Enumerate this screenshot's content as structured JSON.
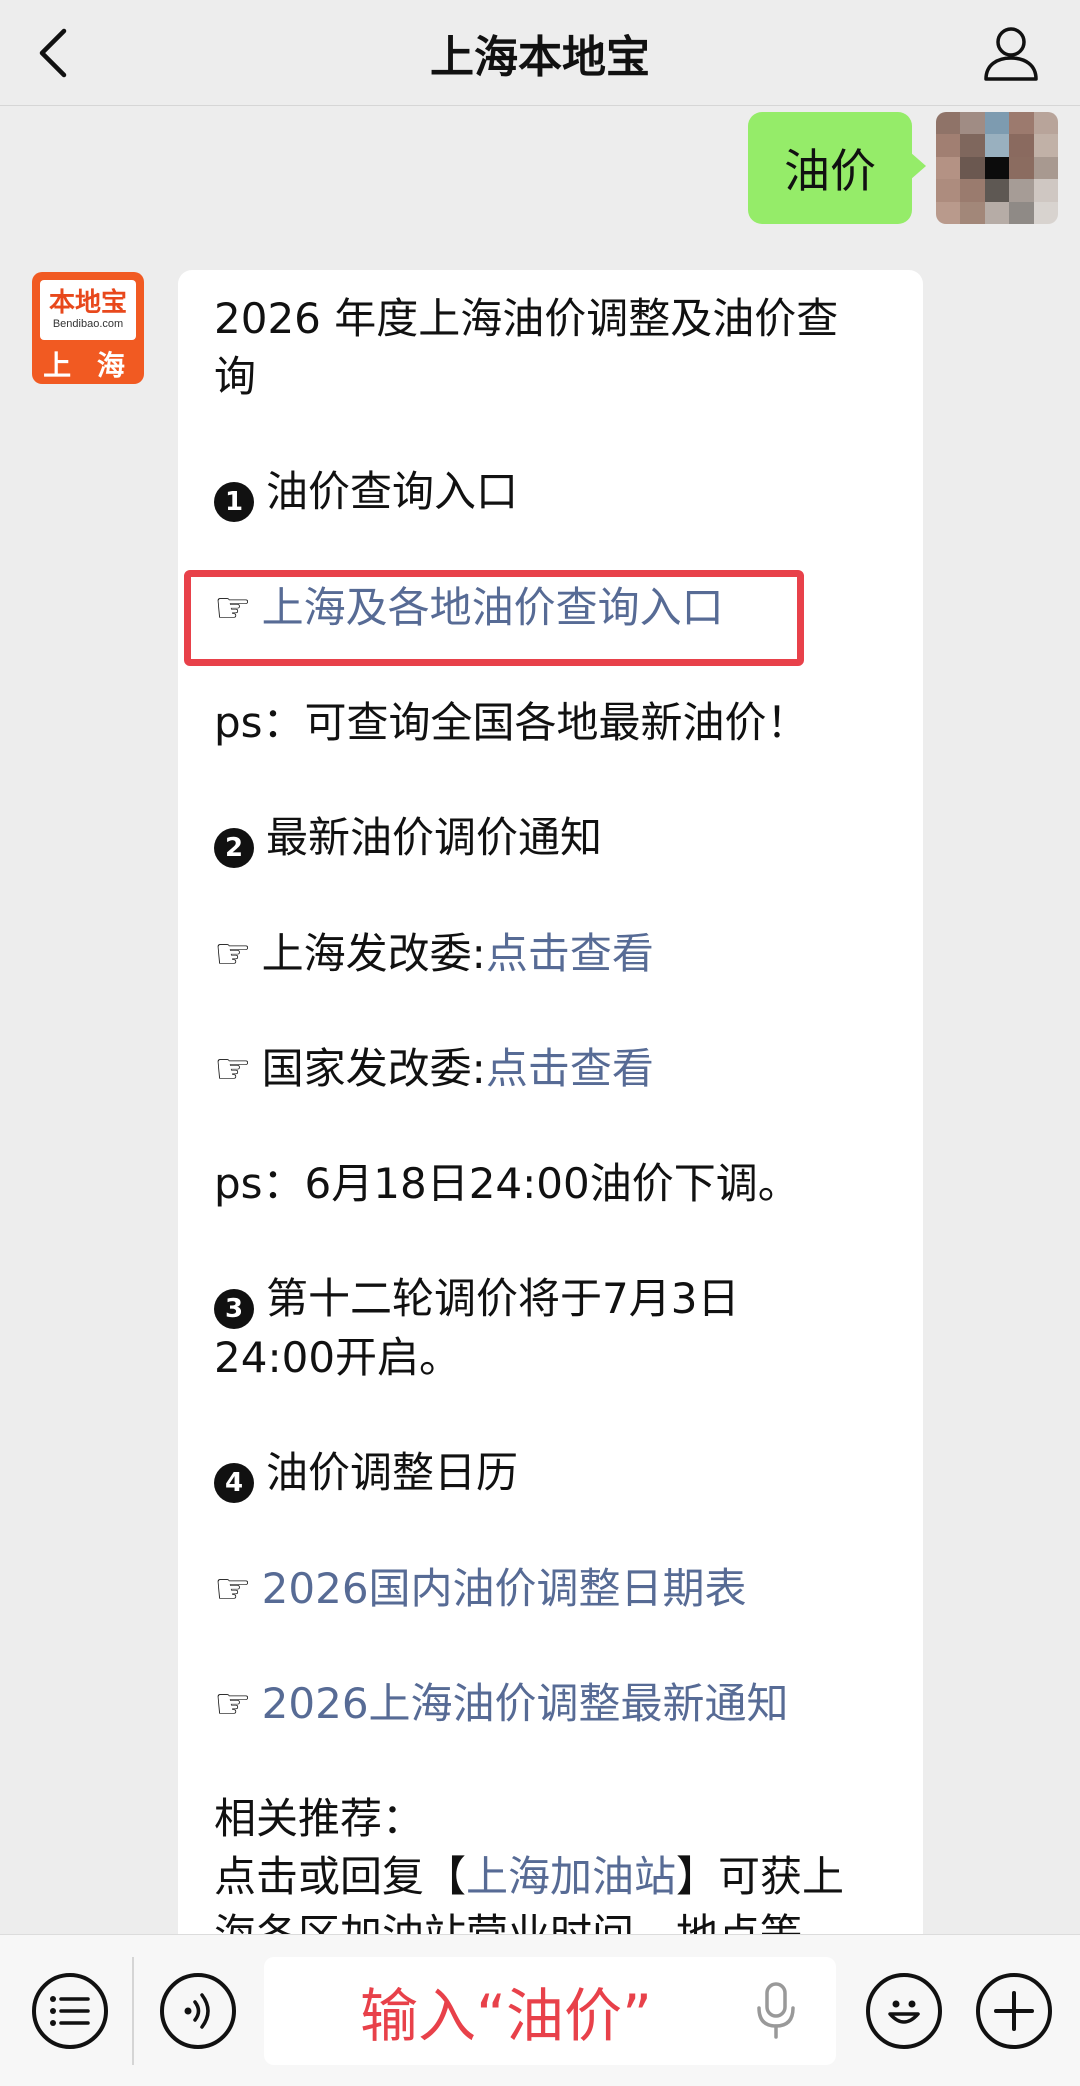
{
  "header": {
    "title": "上海本地宝"
  },
  "user_message": {
    "text": "油价"
  },
  "bot": {
    "avatar_brand": "本地宝",
    "avatar_url": "Bendibao.com",
    "avatar_city": "上 海"
  },
  "reply": {
    "title": "2026年度上海油价调整及油价查询",
    "title_line1": "2026 年度上海油价调整及油价查",
    "title_line2": "询",
    "section1": {
      "badge": "1",
      "heading": "油价查询入口"
    },
    "link_query": "上海及各地油价查询入口",
    "note1": "ps：可查询全国各地最新油价！",
    "section2": {
      "badge": "2",
      "heading": "最新油价调价通知"
    },
    "sh_ndrc_label": "上海发改委:",
    "sh_ndrc_link": "点击查看",
    "national_ndrc_label": "国家发改委:",
    "national_ndrc_link": "点击查看",
    "note2": "ps：6月18日24:00油价下调。",
    "section3": {
      "badge": "3",
      "line1": "第十二轮调价将于7月3日",
      "line2": "24:00开启。"
    },
    "section4": {
      "badge": "4",
      "heading": "油价调整日历"
    },
    "link_calendar": "2026国内油价调整日期表",
    "link_notice": "2026上海油价调整最新通知",
    "related_label": "相关推荐：",
    "related_prefix": "点击或回复【",
    "related_link": "上海加油站",
    "related_suffix": "】可获上",
    "related_cutoff": "海各区加油站营业时间、地点等"
  },
  "hand_icon": "☞",
  "input": {
    "value": "输入“油价”"
  },
  "colors": {
    "bubble_green": "#95ec69",
    "link_blue": "#576b95",
    "highlight_red": "#e8414a",
    "brand_orange": "#f15a22"
  }
}
